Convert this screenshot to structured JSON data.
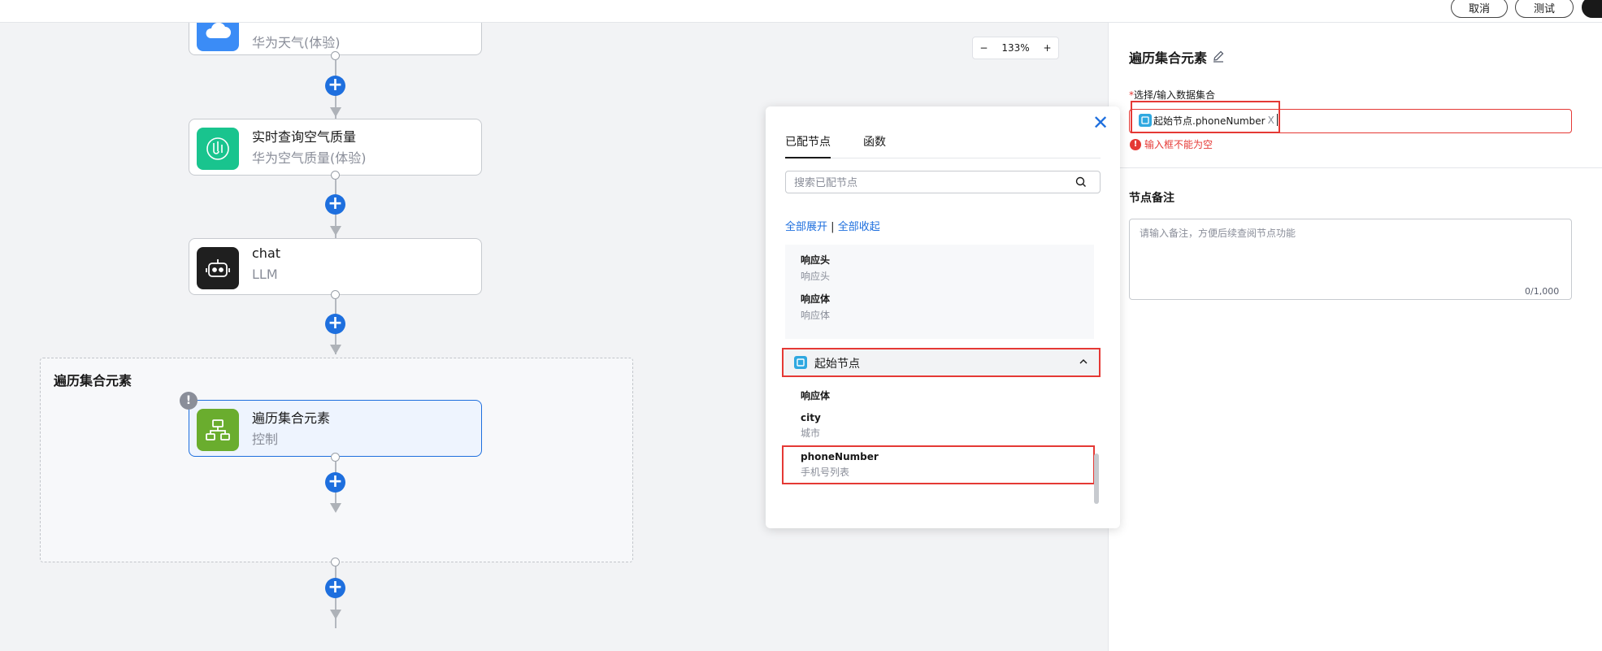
{
  "toolbar": {
    "cancel_label": "取消",
    "test_label": "测试"
  },
  "zoom": {
    "minus": "−",
    "level": "133%",
    "plus": "+"
  },
  "nodes": [
    {
      "subtitle": "华为天气(体验)"
    },
    {
      "title": "实时查询空气质量",
      "subtitle": "华为空气质量(体验)"
    },
    {
      "title": "chat",
      "subtitle": "LLM"
    },
    {
      "title": "遍历集合元素",
      "subtitle": "控制"
    }
  ],
  "loop": {
    "title": "遍历集合元素",
    "warn": "!"
  },
  "popover": {
    "close": "✕",
    "tabs": [
      "已配节点",
      "函数"
    ],
    "search_placeholder": "搜索已配节点",
    "expand_all": "全部展开",
    "separator": "|",
    "collapse_all": "全部收起",
    "fields_top": [
      {
        "name": "响应头",
        "desc": "响应头"
      },
      {
        "name": "响应体",
        "desc": "响应体"
      }
    ],
    "group": {
      "title": "起始节点"
    },
    "group_fields": [
      {
        "name": "响应体"
      },
      {
        "name": "city",
        "desc": "城市"
      },
      {
        "name": "phoneNumber",
        "desc": "手机号列表"
      }
    ]
  },
  "panel": {
    "title": "遍历集合元素",
    "req_star": "*",
    "req_label": "选择/输入数据集合",
    "chip_text": "起始节点.phoneNumber",
    "chip_remove": "X",
    "error_icon": "!",
    "error_text": "输入框不能为空",
    "remark_title": "节点备注",
    "remark_placeholder": "请输入备注，方便后续查阅节点功能",
    "remark_count": "0/1,000"
  },
  "colors": {
    "accent": "#1e6fde",
    "error": "#e53935",
    "teal": "#19c48e",
    "cloud": "#3b8cf6",
    "green": "#6aad2e",
    "dark": "#1f1f1f"
  }
}
